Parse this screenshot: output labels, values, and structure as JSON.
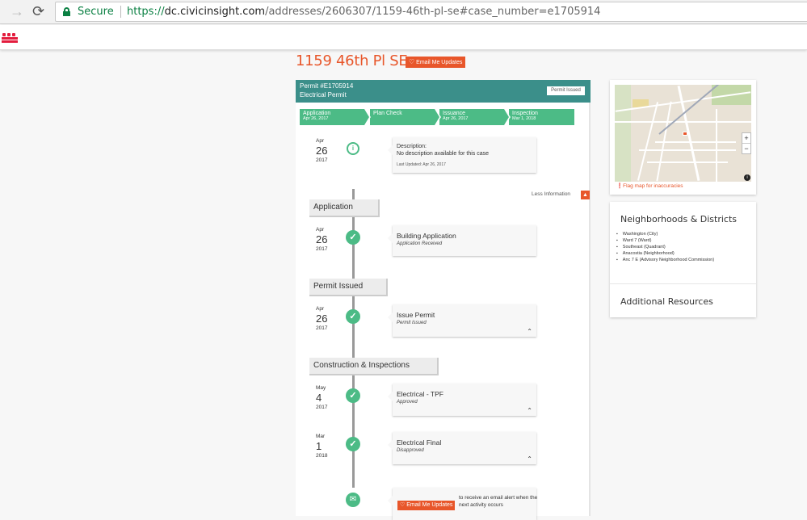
{
  "browser": {
    "secure_label": "Secure",
    "url_scheme": "https://",
    "url_host": "dc.civicinsight.com",
    "url_path": "/addresses/2606307/1159-46th-pl-se#case_number=e1705914"
  },
  "page": {
    "title": "1159 46th Pl SE",
    "email_button": "Email Me Updates"
  },
  "permit": {
    "number": "Permit #E1705914",
    "type": "Electrical Permit",
    "status": "Permit Issued",
    "steps": [
      {
        "label": "Application",
        "date": "Apr 26, 2017"
      },
      {
        "label": "Plan Check",
        "date": ""
      },
      {
        "label": "Issuance",
        "date": "Apr 26, 2017"
      },
      {
        "label": "Inspection",
        "date": "Mar 1, 2018"
      }
    ]
  },
  "description": {
    "date": {
      "month": "Apr",
      "day": "26",
      "year": "2017"
    },
    "title": "Description:",
    "text": "No description available for this case",
    "updated": "Last Updated: Apr 26, 2017",
    "less_info": "Less Information"
  },
  "phases": [
    {
      "name": "Application",
      "events": [
        {
          "month": "Apr",
          "day": "26",
          "year": "2017",
          "title": "Building Application",
          "status": "Application Received",
          "expandable": false
        }
      ]
    },
    {
      "name": "Permit Issued",
      "events": [
        {
          "month": "Apr",
          "day": "26",
          "year": "2017",
          "title": "Issue Permit",
          "status": "Permit Issued",
          "expandable": true
        }
      ]
    },
    {
      "name": "Construction & Inspections",
      "events": [
        {
          "month": "May",
          "day": "4",
          "year": "2017",
          "title": "Electrical - TPF",
          "status": "Approved",
          "expandable": true
        },
        {
          "month": "Mar",
          "day": "1",
          "year": "2018",
          "title": "Electrical Final",
          "status": "Disapproved",
          "expandable": true
        }
      ]
    }
  ],
  "cta": {
    "button": "Email Me Updates",
    "text": "to receive an email alert when the next activity occurs"
  },
  "map": {
    "zoom_in": "+",
    "zoom_out": "−",
    "flag_link": "Flag map for inaccuracies"
  },
  "sidebar": {
    "neighborhoods_title": "Neighborhoods & Districts",
    "neighborhoods": [
      "Washington (City)",
      "Ward 7 (Ward)",
      "Southeast (Quadrant)",
      "Anacostia (Neighborhood)",
      "Anc 7 E (Advisory Neighborhood Commission)"
    ],
    "additional_resources": "Additional Resources"
  },
  "colors": {
    "accent": "#e8562a",
    "teal": "#3b8f8a",
    "green": "#4cbb86"
  }
}
